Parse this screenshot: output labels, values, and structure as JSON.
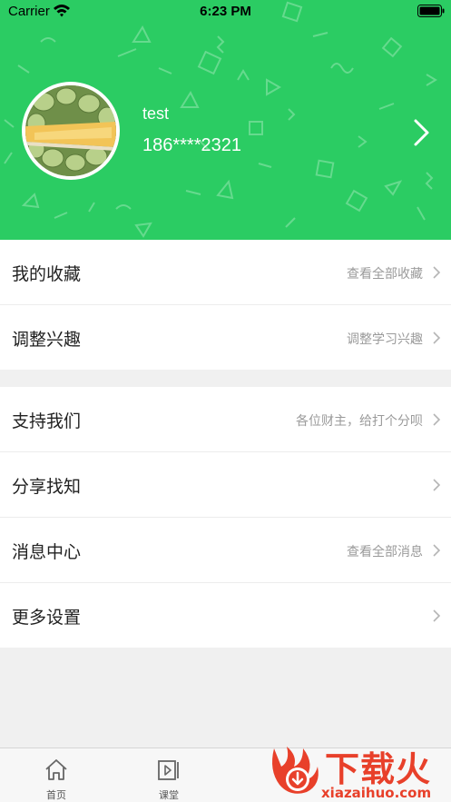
{
  "status_bar": {
    "carrier": "Carrier",
    "time": "6:23 PM"
  },
  "profile": {
    "username": "test",
    "phone": "186****2321"
  },
  "menu_group_1": [
    {
      "title": "我的收藏",
      "subtitle": "查看全部收藏"
    },
    {
      "title": "调整兴趣",
      "subtitle": "调整学习兴趣"
    }
  ],
  "menu_group_2": [
    {
      "title": "支持我们",
      "subtitle": "各位财主，给打个分呗"
    },
    {
      "title": "分享找知",
      "subtitle": ""
    },
    {
      "title": "消息中心",
      "subtitle": "查看全部消息"
    },
    {
      "title": "更多设置",
      "subtitle": ""
    }
  ],
  "tabbar": {
    "tabs": [
      {
        "label": "首页",
        "icon": "home-icon"
      },
      {
        "label": "课堂",
        "icon": "classroom-icon"
      }
    ]
  },
  "watermark": {
    "title": "下载火",
    "url": "xiazaihuo.com"
  },
  "colors": {
    "brand_green": "#2bcc63",
    "watermark_red": "#e8402a"
  }
}
